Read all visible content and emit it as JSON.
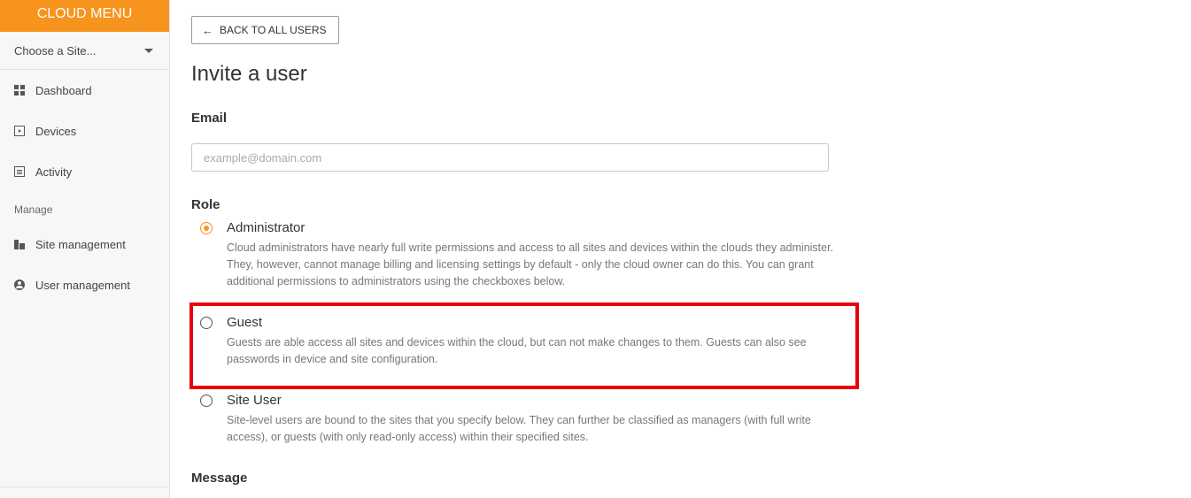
{
  "sidebar": {
    "header": "CLOUD MENU",
    "site_select": "Choose a Site...",
    "nav": [
      {
        "label": "Dashboard",
        "icon": "dashboard-icon"
      },
      {
        "label": "Devices",
        "icon": "devices-icon"
      },
      {
        "label": "Activity",
        "icon": "activity-icon"
      }
    ],
    "manage_label": "Manage",
    "manage_nav": [
      {
        "label": "Site management",
        "icon": "building-icon"
      },
      {
        "label": "User management",
        "icon": "user-icon"
      }
    ]
  },
  "main": {
    "back_button": "BACK TO ALL USERS",
    "title": "Invite a user",
    "email_label": "Email",
    "email_placeholder": "example@domain.com",
    "email_value": "",
    "role_label": "Role",
    "roles": [
      {
        "title": "Administrator",
        "selected": true,
        "description": "Cloud administrators have nearly full write permissions and access to all sites and devices within the clouds they administer. They, however, cannot manage billing and licensing settings by default - only the cloud owner can do this. You can grant additional permissions to administrators using the checkboxes below."
      },
      {
        "title": "Guest",
        "selected": false,
        "description": "Guests are able access all sites and devices within the cloud, but can not make changes to them. Guests can also see passwords in device and site configuration."
      },
      {
        "title": "Site User",
        "selected": false,
        "description": "Site-level users are bound to the sites that you specify below. They can further be classified as managers (with full write access), or guests (with only read-only access) within their specified sites."
      }
    ],
    "message_label": "Message"
  },
  "colors": {
    "accent": "#f7941d",
    "highlight": "#e8000d"
  }
}
